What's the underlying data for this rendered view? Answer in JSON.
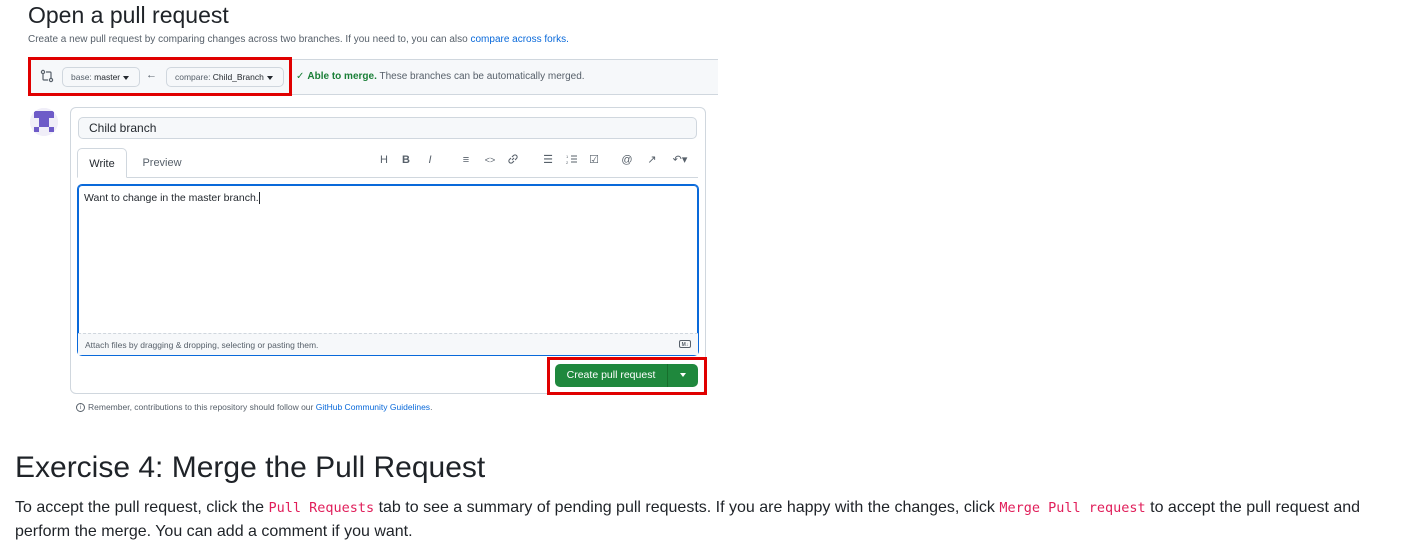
{
  "screenshot": {
    "title": "Open a pull request",
    "subtitle_text": "Create a new pull request by comparing changes across two branches. If you need to, you can also ",
    "subtitle_link": "compare across forks.",
    "compare_bar": {
      "base_prefix": "base: ",
      "base_branch": "master",
      "compare_prefix": "compare: ",
      "compare_branch": "Child_Branch",
      "arrow": "←",
      "merge_ok": "Able to merge.",
      "merge_detail": " These branches can be automatically merged."
    },
    "form": {
      "title_value": "Child branch",
      "tabs": [
        "Write",
        "Preview"
      ],
      "toolbar": [
        "H",
        "B",
        "I",
        "≡",
        "<>",
        "🔗",
        "☰",
        "⅓",
        "☑",
        "@",
        "↗",
        "↶▾"
      ],
      "body_value": "Want to change in the master branch.",
      "attach_text": "Attach files by dragging & dropping, selecting or pasting them.",
      "markdown_icon": "M↓",
      "submit_label": "Create pull request"
    },
    "remember_text": "Remember, contributions to this repository should follow our ",
    "remember_link": "GitHub Community Guidelines",
    "remember_end": "."
  },
  "doc": {
    "heading": "Exercise 4: Merge the Pull Request",
    "para_1": "To accept the pull request, click the ",
    "code_1": "Pull Requests",
    "para_2": " tab to see a summary of pending pull requests. If you are happy with the changes, click ",
    "code_2": "Merge Pull request",
    "para_3": " to accept the pull request and perform the merge. You can add a comment if you want."
  },
  "colors": {
    "accent_green": "#1f883d",
    "highlight_red": "#e00000",
    "link_blue": "#0969da",
    "code_pink": "#e01e5a"
  }
}
